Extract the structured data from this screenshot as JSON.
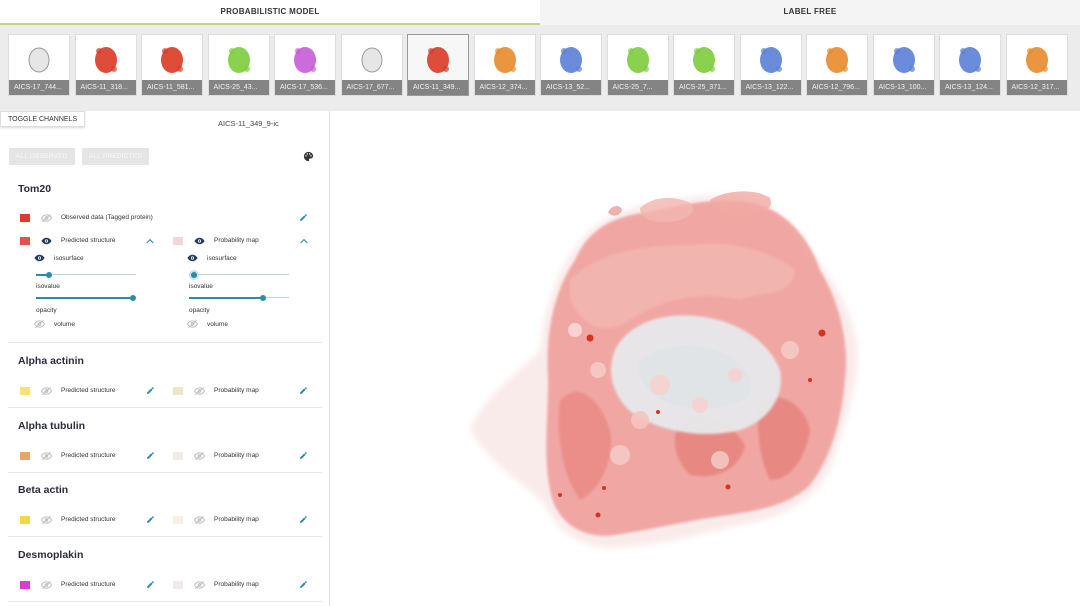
{
  "tabs": [
    {
      "label": "PROBABILISTIC MODEL",
      "active": true
    },
    {
      "label": "LABEL FREE",
      "active": false
    }
  ],
  "thumbnails": [
    {
      "label": "AICS-17_744...",
      "color": "#e2e2e2",
      "selected": false
    },
    {
      "label": "AICS-11_318...",
      "color": "#d93a25",
      "selected": false
    },
    {
      "label": "AICS-11_581...",
      "color": "#d93a25",
      "selected": false
    },
    {
      "label": "AICS-25_43...",
      "color": "#7dcc3c",
      "selected": false
    },
    {
      "label": "AICS-17_536...",
      "color": "#c65bd6",
      "selected": false
    },
    {
      "label": "AICS-17_677...",
      "color": "#e2e2e2",
      "selected": false
    },
    {
      "label": "AICS-11_349...",
      "color": "#d93a25",
      "selected": true
    },
    {
      "label": "AICS-12_374...",
      "color": "#e88a2a",
      "selected": false
    },
    {
      "label": "AICS-13_52...",
      "color": "#5a7fd6",
      "selected": false
    },
    {
      "label": "AICS-25_7...",
      "color": "#7dcc3c",
      "selected": false
    },
    {
      "label": "AICS-25_371...",
      "color": "#7dcc3c",
      "selected": false
    },
    {
      "label": "AICS-13_122...",
      "color": "#5a7fd6",
      "selected": false
    },
    {
      "label": "AICS-12_796...",
      "color": "#e88a2a",
      "selected": false
    },
    {
      "label": "AICS-13_100...",
      "color": "#5a7fd6",
      "selected": false
    },
    {
      "label": "AICS-13_124...",
      "color": "#5a7fd6",
      "selected": false
    },
    {
      "label": "AICS-12_317...",
      "color": "#e88a2a",
      "selected": false
    }
  ],
  "panel": {
    "toggle_label": "TOGGLE CHANNELS",
    "cell_id": "AICS-11_349_9-ic",
    "all_observed_label": "ALL OBSERVED",
    "all_predicted_label": "ALL PREDICTED",
    "palette_icon": "palette-icon"
  },
  "tom20": {
    "title": "Tom20",
    "observed": {
      "label": "Observed data (Tagged protein)",
      "color": "#e03a2e",
      "visible": false
    },
    "predicted": {
      "label": "Predicted structure",
      "color": "#e0554a",
      "visible": true,
      "expanded": true
    },
    "probability": {
      "label": "Probability map",
      "color": "#f4d6d6",
      "visible": true,
      "expanded": true
    },
    "predicted_settings": {
      "isosurface_label": "isosurface",
      "isovalue_label": "isovalue",
      "isovalue": 0.13,
      "opacity_label": "opacity",
      "opacity": 0.97,
      "volume_label": "volume"
    },
    "probability_settings": {
      "isosurface_label": "isosurface",
      "isovalue_label": "isovalue",
      "isovalue": 0.05,
      "opacity_label": "opacity",
      "opacity": 0.74,
      "volume_label": "volume"
    }
  },
  "channels": [
    {
      "title": "Alpha actinin",
      "predicted_label": "Predicted structure",
      "probability_label": "Probability map",
      "predicted_color": "#f7e27a",
      "probability_color": "#ece7c8"
    },
    {
      "title": "Alpha tubulin",
      "predicted_label": "Predicted structure",
      "probability_label": "Probability map",
      "predicted_color": "#e8a56a",
      "probability_color": "#f0ebe6"
    },
    {
      "title": "Beta actin",
      "predicted_label": "Predicted structure",
      "probability_label": "Probability map",
      "predicted_color": "#f3d64a",
      "probability_color": "#f5f0df"
    },
    {
      "title": "Desmoplakin",
      "predicted_label": "Predicted structure",
      "probability_label": "Probability map",
      "predicted_color": "#d640d0",
      "probability_color": "#f0eaee"
    }
  ]
}
